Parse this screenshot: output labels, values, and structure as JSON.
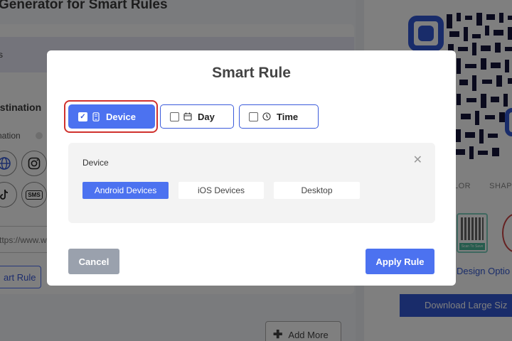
{
  "background": {
    "page_title": "Generator for Smart Rules",
    "destination_heading": "estination",
    "destination_sub": "nation",
    "social_icons": [
      "globe-icon",
      "instagram-icon",
      "tiktok-icon",
      "sms-icon"
    ],
    "sms_label": "SMS",
    "url_value": "ttps://www.w",
    "smart_rule_button": "art Rule",
    "add_more_button": "Add More",
    "tabs": [
      "LOR",
      "SHAPES"
    ],
    "thumbnail_label": "Scan To Save",
    "design_options_link": "Design Optio",
    "download_button": "Download Large Siz"
  },
  "modal": {
    "title": "Smart Rule",
    "rule_types": [
      {
        "label": "Device",
        "checked": true,
        "icon": "mobile-icon"
      },
      {
        "label": "Day",
        "checked": false,
        "icon": "calendar-icon"
      },
      {
        "label": "Time",
        "checked": false,
        "icon": "clock-icon"
      }
    ],
    "device_panel": {
      "label": "Device",
      "options": [
        {
          "label": "Android Devices",
          "selected": true
        },
        {
          "label": "iOS Devices",
          "selected": false
        },
        {
          "label": "Desktop",
          "selected": false
        }
      ]
    },
    "cancel_label": "Cancel",
    "apply_label": "Apply Rule"
  },
  "colors": {
    "accent": "#4c72f0",
    "highlight": "#d0312d",
    "cancel": "#9aa1ad",
    "qr_blue": "#3358d4"
  }
}
